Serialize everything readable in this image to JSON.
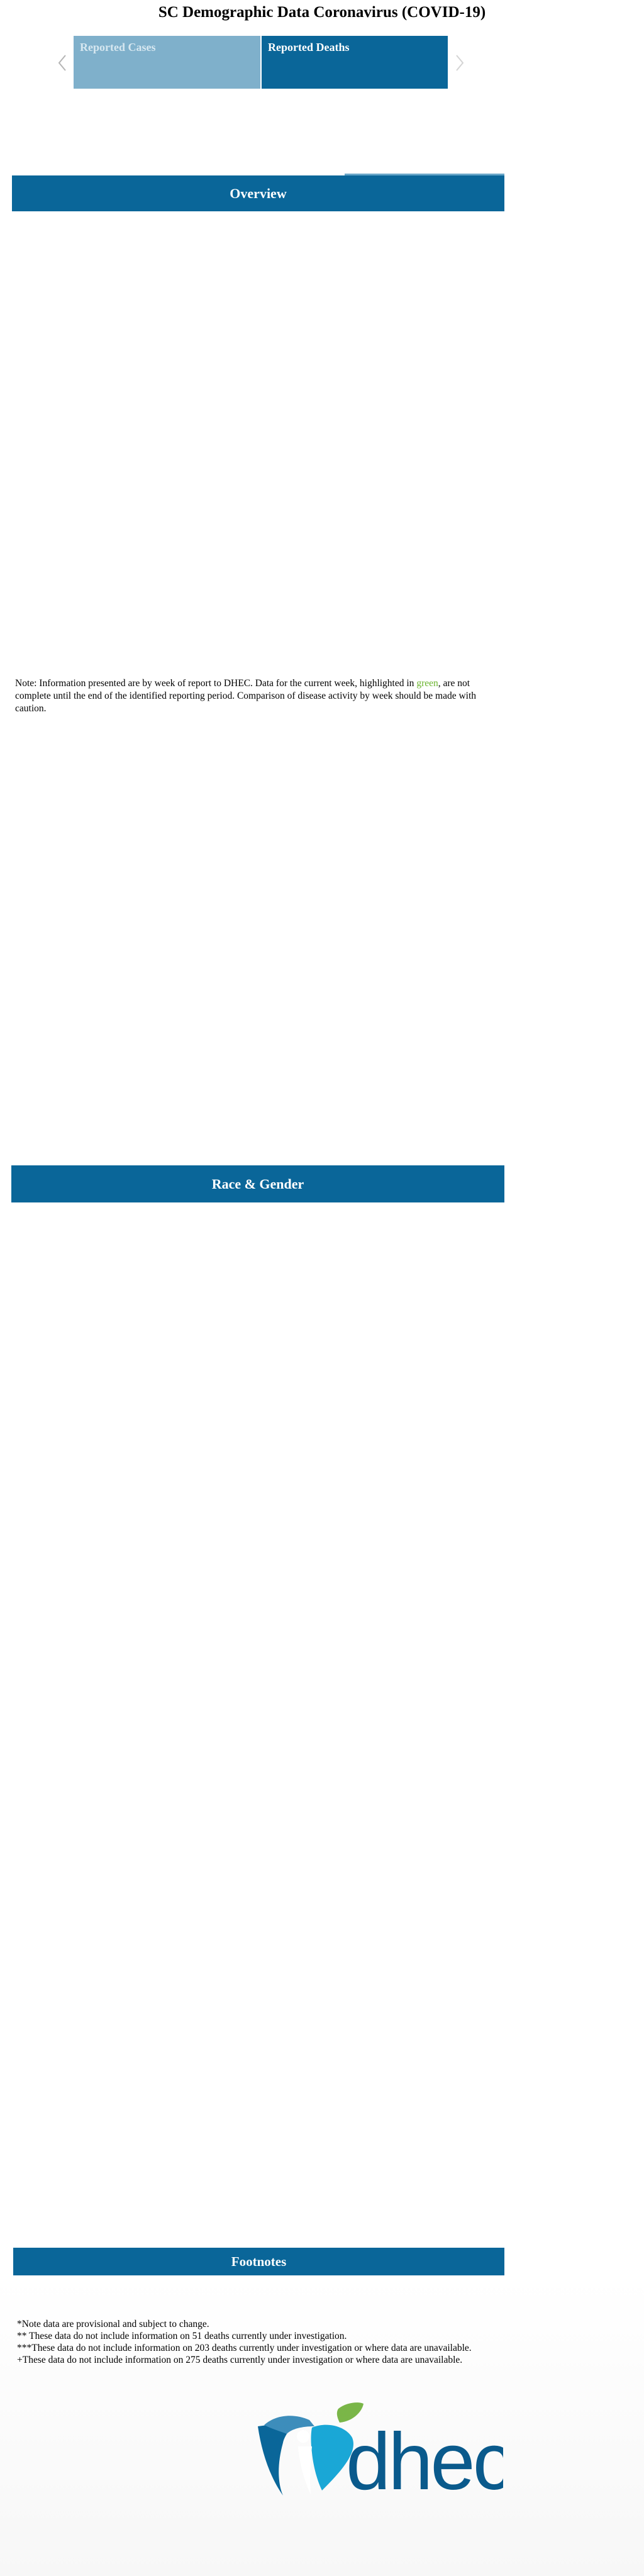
{
  "header": {
    "title": "SC Demographic Data Coronavirus (COVID-19)"
  },
  "tabs": [
    {
      "label": "Reported Cases",
      "selected": false
    },
    {
      "label": "Reported Deaths",
      "selected": true
    }
  ],
  "carousel": {
    "prev_icon": "chevron-left-icon",
    "next_icon": "chevron-right-icon"
  },
  "sections": {
    "overview": "Overview",
    "race_gender": "Race & Gender",
    "footnotes": "Footnotes"
  },
  "note": {
    "before": "Note: Information presented are by week of report to DHEC. Data for the current week, highlighted in ",
    "highlight": "green",
    "after": ", are not complete until the end of the identified reporting period. Comparison of disease activity by week should be made with caution."
  },
  "footnotes": [
    "*Note data are provisional and subject to change.",
    "** These data do not include information on 51 deaths currently under investigation.",
    "***These data do not include information on 203 deaths currently under investigation or where data are unavailable.",
    "+These data do not include information on 275 deaths currently under investigation or where data are unavailable."
  ],
  "logo": {
    "text": "dhec"
  },
  "colors": {
    "primary": "#0a6699",
    "tab_inactive": "#7fb0cb",
    "highlight_green": "#6ab42d",
    "logo_light_blue": "#1aa7d6",
    "logo_green": "#7ab648"
  }
}
